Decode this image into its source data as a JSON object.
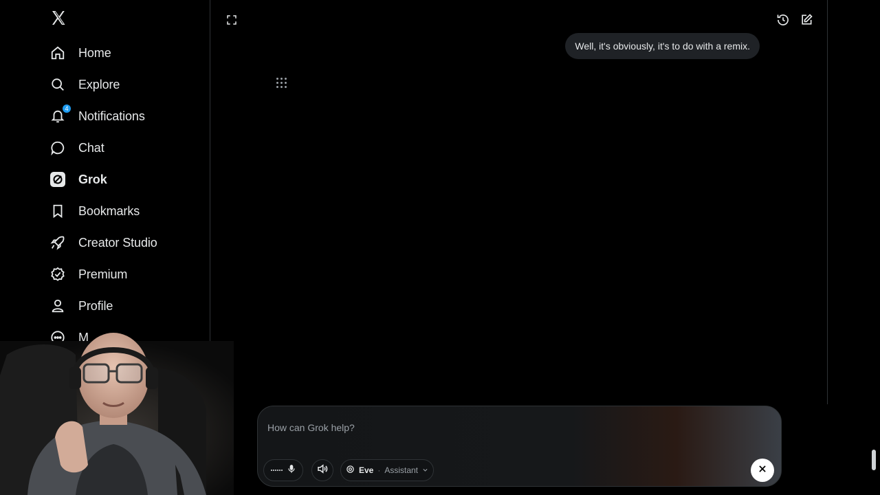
{
  "sidebar": {
    "items": [
      {
        "label": "Home",
        "icon": "home-icon"
      },
      {
        "label": "Explore",
        "icon": "search-icon"
      },
      {
        "label": "Notifications",
        "icon": "bell-icon",
        "badge": "4"
      },
      {
        "label": "Chat",
        "icon": "chat-icon"
      },
      {
        "label": "Grok",
        "icon": "grok-icon",
        "active": true
      },
      {
        "label": "Bookmarks",
        "icon": "bookmark-icon"
      },
      {
        "label": "Creator Studio",
        "icon": "rocket-icon"
      },
      {
        "label": "Premium",
        "icon": "verified-icon"
      },
      {
        "label": "Profile",
        "icon": "person-icon"
      },
      {
        "label": "M",
        "icon": "more-icon"
      }
    ]
  },
  "main": {
    "bubble_text": "Well, it's obviously, it's to do with a remix."
  },
  "composer": {
    "placeholder": "How can Grok help?",
    "persona_name": "Eve",
    "persona_separator": "·",
    "persona_mode": "Assistant"
  },
  "colors": {
    "accent": "#1d9bf0",
    "background": "#000000",
    "text": "#e7e9ea",
    "border": "#2f3336"
  }
}
